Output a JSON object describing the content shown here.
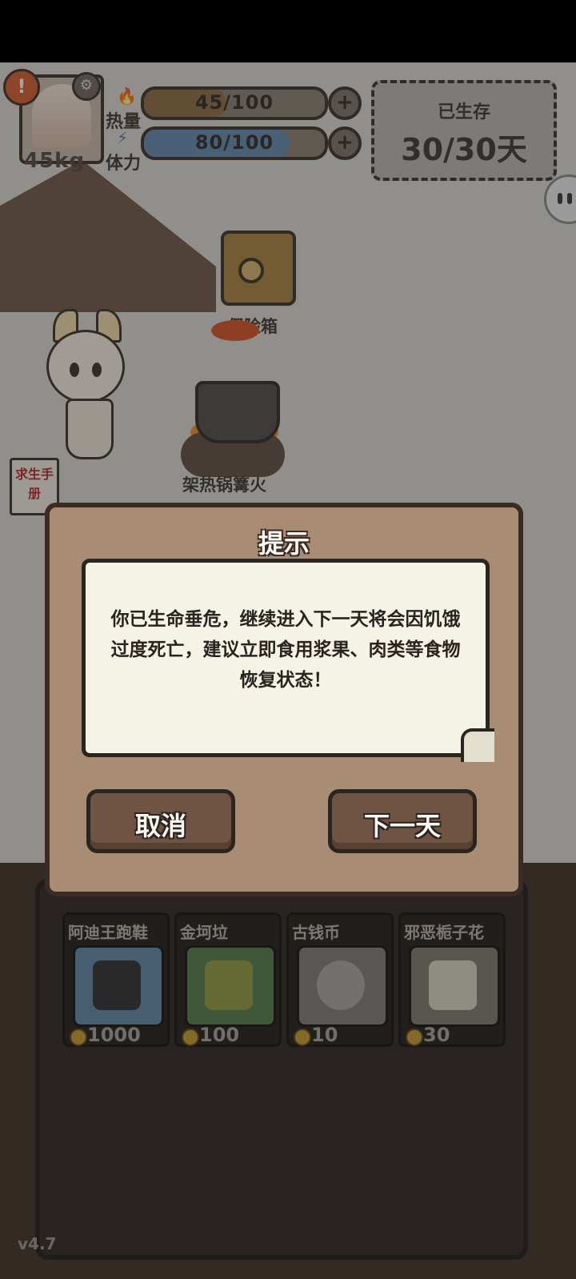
{
  "hud": {
    "weight": "45kg",
    "heat_label": "热量",
    "heat_value": "45/100",
    "heat_fill": 0.45,
    "stamina_label": "体力",
    "stamina_value": "80/100",
    "stamina_fill": 0.8,
    "survived_label": "已生存",
    "survived_value": "30/30天",
    "colors": {
      "heat_bar": "#8c6a3f",
      "stamina_bar": "#5f8ab0",
      "alert": "#d65a2c"
    }
  },
  "world": {
    "safe_label": "保险箱",
    "campfire_label": "架热锅篝火",
    "manual_label": "求生手册"
  },
  "dialog": {
    "title": "提示",
    "message": "你已生命垂危，继续进入下一天将会因饥饿过度死亡，建议立即食用浆果、肉类等食物恢复状态！",
    "cancel_label": "取消",
    "next_label": "下一天"
  },
  "shop": {
    "items": [
      {
        "name": "阿迪王跑鞋",
        "price": "1000",
        "icon": "sneaker-icon"
      },
      {
        "name": "金坷垃",
        "price": "100",
        "icon": "fertilizer-bag-icon"
      },
      {
        "name": "古钱币",
        "price": "10",
        "icon": "coin-icon"
      },
      {
        "name": "邪恶栀子花",
        "price": "30",
        "icon": "book-icon"
      }
    ]
  },
  "version": "v4.7"
}
